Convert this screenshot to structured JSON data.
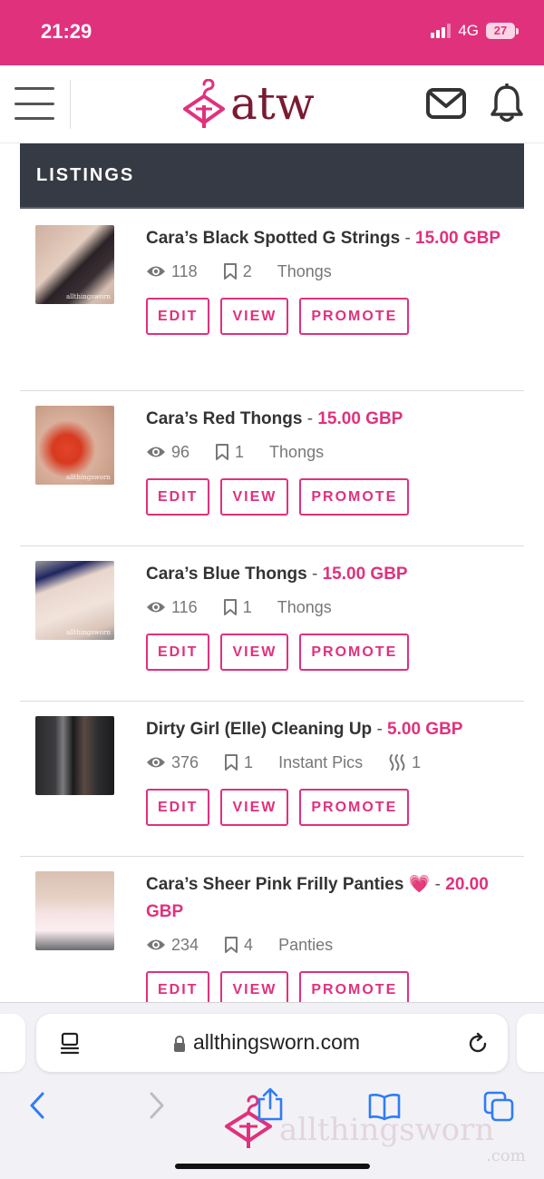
{
  "status_bar": {
    "time": "21:29",
    "network": "4G",
    "battery": "27"
  },
  "header": {
    "logo_text": "atw",
    "icons": [
      "menu-icon",
      "mail-icon",
      "bell-icon"
    ]
  },
  "listings": {
    "title": "LISTINGS",
    "items": [
      {
        "name": "Cara’s Black Spotted G Strings",
        "separator": "-",
        "price": "15.00 GBP",
        "views": "118",
        "saves": "2",
        "category": "Thongs",
        "extra": ""
      },
      {
        "name": "Cara’s Red Thongs",
        "separator": "-",
        "price": "15.00 GBP",
        "views": "96",
        "saves": "1",
        "category": "Thongs",
        "extra": ""
      },
      {
        "name": "Cara’s Blue Thongs",
        "separator": "-",
        "price": "15.00 GBP",
        "views": "116",
        "saves": "1",
        "category": "Thongs",
        "extra": ""
      },
      {
        "name": "Dirty Girl (Elle) Cleaning Up",
        "separator": "-",
        "price": "5.00 GBP",
        "views": "376",
        "saves": "1",
        "category": "Instant Pics",
        "extra": "1"
      },
      {
        "name": "Cara’s Sheer Pink Frilly Panties 💗",
        "separator": "-",
        "price": "20.00 GBP",
        "views": "234",
        "saves": "4",
        "category": "Panties",
        "extra": ""
      }
    ],
    "actions": {
      "edit": "EDIT",
      "view": "VIEW",
      "promote": "PROMOTE"
    },
    "thumb_watermark": "allthingsworn"
  },
  "browser": {
    "url": "allthingsworn.com"
  },
  "watermark": {
    "brand": "allthingsworn",
    "sub": ".com"
  },
  "colors": {
    "accent": "#e0317d",
    "logo": "#7a1b32",
    "listings_bar": "#363a44"
  }
}
